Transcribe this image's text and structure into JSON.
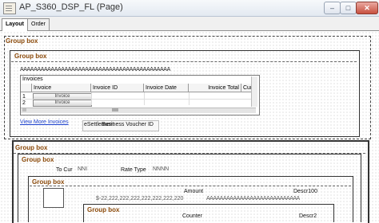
{
  "window": {
    "title": "AP_S360_DSP_FL (Page)",
    "buttons": {
      "minimize": "–",
      "maximize": "□",
      "close": "✕"
    }
  },
  "tabs": [
    {
      "label": "Layout",
      "active": true
    },
    {
      "label": "Order",
      "active": false
    }
  ],
  "layout": {
    "group_box_label": "Group box",
    "top_group": {
      "inner_group_label": "Group box",
      "text_placeholder": "AAAAAAAAAAAAAAAAAAAAAAAAAAAAAAAAAAAAAAAAAAAA",
      "grid": {
        "title": "Invoices",
        "columns": [
          "Invoice",
          "Invoice ID",
          "Invoice Date",
          "Invoice Total",
          "Cur"
        ],
        "row_numbers": [
          "1",
          "2"
        ],
        "row_button_label": "Invoice"
      },
      "view_more_link": "View More Invoices",
      "overlapping_fields": {
        "left": "eSettlement",
        "right": "Business Voucher ID"
      }
    },
    "bottom_group": {
      "label": "Group box",
      "level2": {
        "label": "Group box",
        "to_cur_label": "To Cur",
        "to_cur_value": "NNI",
        "rate_type_label": "Rate Type",
        "rate_type_value": "NNNN",
        "level3": {
          "label": "Group box",
          "amount_label": "Amount",
          "amount_value": "$-22,222,222,222,222,222,222,220",
          "descr100_label": "Descr100",
          "descr100_value": "AAAAAAAAAAAAAAAAAAAAAAAAAAAA",
          "level4": {
            "label": "Group box",
            "counter_label": "Counter",
            "descr2_label": "Descr2"
          }
        }
      }
    }
  },
  "colors": {
    "group_label": "#8b4a0a",
    "link": "#1a3fcc"
  }
}
